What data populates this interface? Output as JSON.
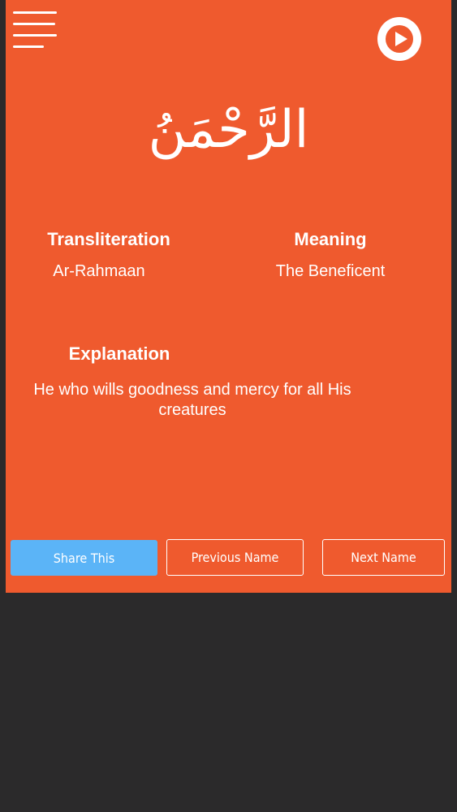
{
  "name": {
    "arabic": "الرَّحْمَنُ",
    "transliteration_label": "Transliteration",
    "transliteration": "Ar-Rahmaan",
    "meaning_label": "Meaning",
    "meaning": "The Beneficent",
    "explanation_label": "Explanation",
    "explanation": "He who wills goodness and mercy for all His creatures"
  },
  "buttons": {
    "share": "Share This",
    "previous": "Previous Name",
    "next": "Next Name"
  },
  "icons": {
    "menu": "hamburger-menu-icon",
    "play": "play-icon"
  },
  "colors": {
    "background": "#ef5a2e",
    "share_button": "#5bb4f7",
    "page": "#2b2a2b"
  }
}
